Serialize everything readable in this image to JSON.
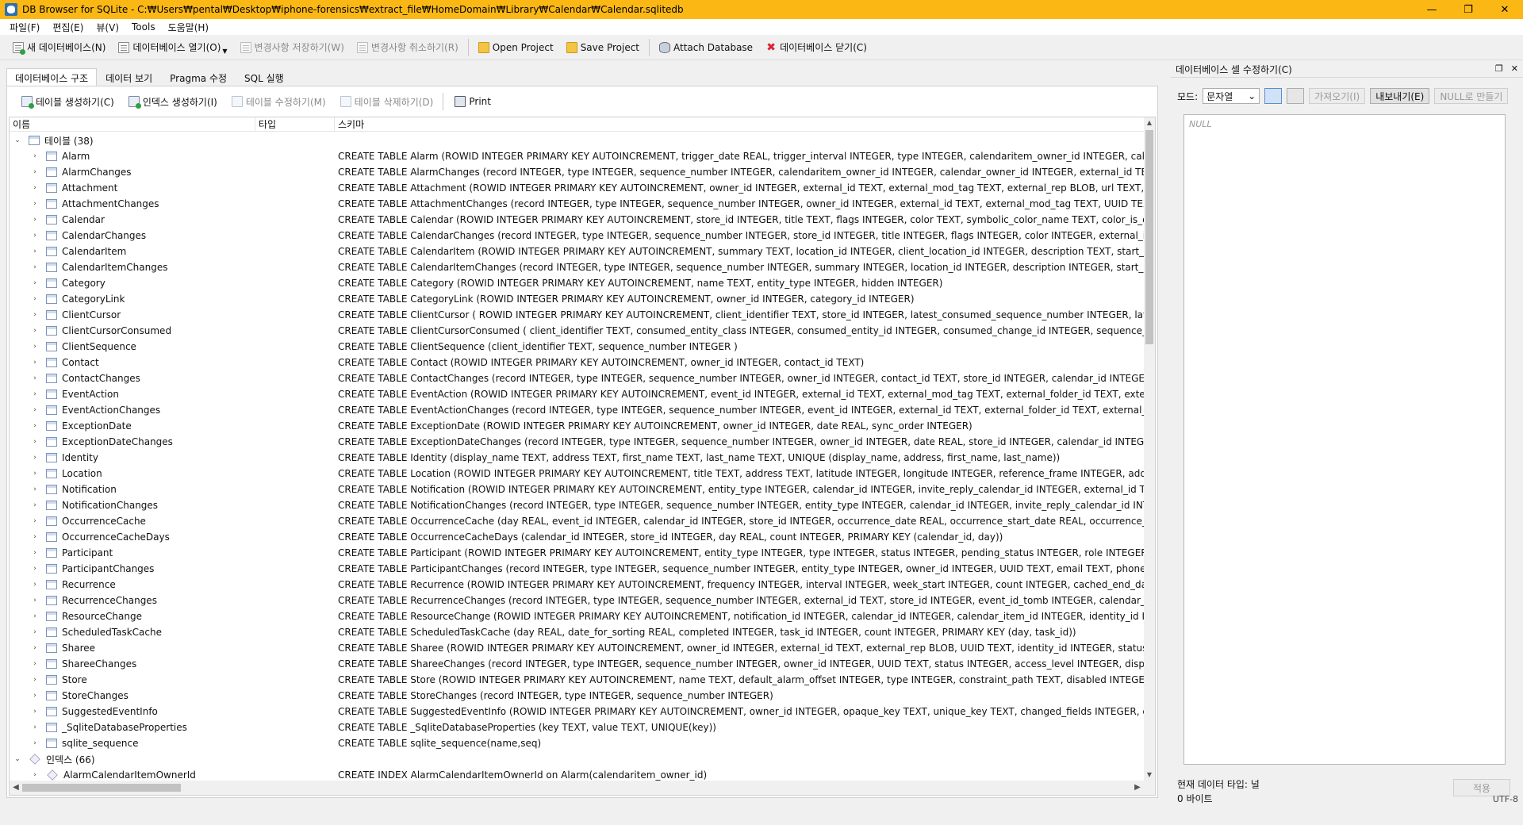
{
  "window": {
    "title": "DB Browser for SQLite - C:₩Users₩pental₩Desktop₩iphone-forensics₩extract_file₩HomeDomain₩Library₩Calendar₩Calendar.sqlitedb",
    "minimize": "—",
    "maximize": "❐",
    "close": "✕"
  },
  "menu": [
    "파일(F)",
    "편집(E)",
    "뷰(V)",
    "Tools",
    "도움말(H)"
  ],
  "toolbar": {
    "new_db": "새 데이터베이스(N)",
    "open_db": "데이터베이스 열기(O)",
    "write_changes": "변경사항 저장하기(W)",
    "revert_changes": "변경사항 취소하기(R)",
    "open_project": "Open Project",
    "save_project": "Save Project",
    "attach_db": "Attach Database",
    "close_db": "데이터베이스 닫기(C)"
  },
  "tabs": [
    "데이터베이스 구조",
    "데이터 보기",
    "Pragma 수정",
    "SQL 실행"
  ],
  "structure": {
    "actions": {
      "create_table": "테이블 생성하기(C)",
      "create_index": "인덱스 생성하기(I)",
      "modify_table": "테이블 수정하기(M)",
      "delete_table": "테이블 삭제하기(D)",
      "print": "Print"
    },
    "headers": {
      "name": "이름",
      "type": "타입",
      "schema": "스키마"
    },
    "tables_label": "테이블 (38)",
    "indexes_label": "인덱스 (66)",
    "tables": [
      {
        "name": "Alarm",
        "schema": "CREATE TABLE Alarm (ROWID INTEGER PRIMARY KEY AUTOINCREMENT, trigger_date REAL, trigger_interval INTEGER, type INTEGER, calendaritem_owner_id INTEGER, calendar_owner_id INTEGE"
      },
      {
        "name": "AlarmChanges",
        "schema": "CREATE TABLE AlarmChanges (record INTEGER, type INTEGER, sequence_number INTEGER, calendaritem_owner_id INTEGER, calendar_owner_id INTEGER, external_id TEXT, store_id INTEGER, cal"
      },
      {
        "name": "Attachment",
        "schema": "CREATE TABLE Attachment (ROWID INTEGER PRIMARY KEY AUTOINCREMENT, owner_id INTEGER, external_id TEXT, external_mod_tag TEXT, external_rep BLOB, url TEXT, UUID TEXT, data BLOB"
      },
      {
        "name": "AttachmentChanges",
        "schema": "CREATE TABLE AttachmentChanges (record INTEGER, type INTEGER, sequence_number INTEGER, owner_id INTEGER, external_id TEXT, external_mod_tag TEXT, UUID TEXT, store_id INTEGER, cale"
      },
      {
        "name": "Calendar",
        "schema": "CREATE TABLE Calendar (ROWID INTEGER PRIMARY KEY AUTOINCREMENT, store_id INTEGER, title TEXT, flags INTEGER, color TEXT, symbolic_color_name TEXT, color_is_display INTEGER, type T"
      },
      {
        "name": "CalendarChanges",
        "schema": "CREATE TABLE CalendarChanges (record INTEGER, type INTEGER, sequence_number INTEGER, store_id INTEGER, title INTEGER, flags INTEGER, color INTEGER, external_id TEXT, external_id_tag TE"
      },
      {
        "name": "CalendarItem",
        "schema": "CREATE TABLE CalendarItem (ROWID INTEGER PRIMARY KEY AUTOINCREMENT, summary TEXT, location_id INTEGER, client_location_id INTEGER, description TEXT, start_date REAL, start_tz TEX"
      },
      {
        "name": "CalendarItemChanges",
        "schema": "CREATE TABLE CalendarItemChanges (record INTEGER, type INTEGER, sequence_number INTEGER, summary INTEGER, location_id INTEGER, description INTEGER, start_date INTEGER, start_tz INT"
      },
      {
        "name": "Category",
        "schema": "CREATE TABLE Category (ROWID INTEGER PRIMARY KEY AUTOINCREMENT, name TEXT, entity_type INTEGER, hidden INTEGER)"
      },
      {
        "name": "CategoryLink",
        "schema": "CREATE TABLE CategoryLink (ROWID INTEGER PRIMARY KEY AUTOINCREMENT, owner_id INTEGER, category_id INTEGER)"
      },
      {
        "name": "ClientCursor",
        "schema": "CREATE TABLE ClientCursor ( ROWID INTEGER PRIMARY KEY AUTOINCREMENT, client_identifier TEXT, store_id INTEGER, latest_consumed_sequence_number INTEGER, latest_consumed_timesta"
      },
      {
        "name": "ClientCursorConsumed",
        "schema": "CREATE TABLE ClientCursorConsumed ( client_identifier TEXT, consumed_entity_class INTEGER, consumed_entity_id INTEGER, consumed_change_id INTEGER, sequence_number INTEGER )"
      },
      {
        "name": "ClientSequence",
        "schema": "CREATE TABLE ClientSequence (client_identifier TEXT, sequence_number INTEGER )"
      },
      {
        "name": "Contact",
        "schema": "CREATE TABLE Contact (ROWID INTEGER PRIMARY KEY AUTOINCREMENT, owner_id INTEGER, contact_id TEXT)"
      },
      {
        "name": "ContactChanges",
        "schema": "CREATE TABLE ContactChanges (record INTEGER, type INTEGER, sequence_number INTEGER, owner_id INTEGER, contact_id TEXT, store_id INTEGER, calendar_id INTEGER)"
      },
      {
        "name": "EventAction",
        "schema": "CREATE TABLE EventAction (ROWID INTEGER PRIMARY KEY AUTOINCREMENT, event_id INTEGER, external_id TEXT, external_mod_tag TEXT, external_folder_id TEXT, external_schedule_id TEXT, e"
      },
      {
        "name": "EventActionChanges",
        "schema": "CREATE TABLE EventActionChanges (record INTEGER, type INTEGER, sequence_number INTEGER, event_id INTEGER, external_id TEXT, external_folder_id TEXT, external_schedule_id TEXT, store_ic"
      },
      {
        "name": "ExceptionDate",
        "schema": "CREATE TABLE ExceptionDate (ROWID INTEGER PRIMARY KEY AUTOINCREMENT, owner_id INTEGER, date REAL, sync_order INTEGER)"
      },
      {
        "name": "ExceptionDateChanges",
        "schema": "CREATE TABLE ExceptionDateChanges (record INTEGER, type INTEGER, sequence_number INTEGER, owner_id INTEGER, date REAL, store_id INTEGER, calendar_id INTEGER)"
      },
      {
        "name": "Identity",
        "schema": "CREATE TABLE Identity (display_name TEXT, address TEXT, first_name TEXT, last_name TEXT, UNIQUE (display_name, address, first_name, last_name))"
      },
      {
        "name": "Location",
        "schema": "CREATE TABLE Location (ROWID INTEGER PRIMARY KEY AUTOINCREMENT, title TEXT, address TEXT, latitude INTEGER, longitude INTEGER, reference_frame INTEGER, address_book_id TEXT, ma"
      },
      {
        "name": "Notification",
        "schema": "CREATE TABLE Notification (ROWID INTEGER PRIMARY KEY AUTOINCREMENT, entity_type INTEGER, calendar_id INTEGER, invite_reply_calendar_id INTEGER, external_id TEXT, external_mod_tag"
      },
      {
        "name": "NotificationChanges",
        "schema": "CREATE TABLE NotificationChanges (record INTEGER, type INTEGER, sequence_number INTEGER, entity_type INTEGER, calendar_id INTEGER, invite_reply_calendar_id INTEGER, external_id TEXT,"
      },
      {
        "name": "OccurrenceCache",
        "schema": "CREATE TABLE OccurrenceCache (day REAL, event_id INTEGER, calendar_id INTEGER, store_id INTEGER, occurrence_date REAL, occurrence_start_date REAL, occurrence_end_date REAL)"
      },
      {
        "name": "OccurrenceCacheDays",
        "schema": "CREATE TABLE OccurrenceCacheDays (calendar_id INTEGER, store_id INTEGER, day REAL, count INTEGER, PRIMARY KEY (calendar_id, day))"
      },
      {
        "name": "Participant",
        "schema": "CREATE TABLE Participant (ROWID INTEGER PRIMARY KEY AUTOINCREMENT, entity_type INTEGER, type INTEGER, status INTEGER, pending_status INTEGER, role INTEGER, identity_id INTEGER, o"
      },
      {
        "name": "ParticipantChanges",
        "schema": "CREATE TABLE ParticipantChanges (record INTEGER, type INTEGER, sequence_number INTEGER, entity_type INTEGER, owner_id INTEGER, UUID TEXT, email TEXT, phone_number TEXT, commen"
      },
      {
        "name": "Recurrence",
        "schema": "CREATE TABLE Recurrence (ROWID INTEGER PRIMARY KEY AUTOINCREMENT, frequency INTEGER, interval INTEGER, week_start INTEGER, count INTEGER, cached_end_date REAL, cached_end_c"
      },
      {
        "name": "RecurrenceChanges",
        "schema": "CREATE TABLE RecurrenceChanges (record INTEGER, type INTEGER, sequence_number INTEGER, external_id TEXT, store_id INTEGER, event_id_tomb INTEGER, calendar_id INTEGER, end_date_tor"
      },
      {
        "name": "ResourceChange",
        "schema": "CREATE TABLE ResourceChange (ROWID INTEGER PRIMARY KEY AUTOINCREMENT, notification_id INTEGER, calendar_id INTEGER, calendar_item_id INTEGER, identity_id INTEGER, change_type"
      },
      {
        "name": "ScheduledTaskCache",
        "schema": "CREATE TABLE ScheduledTaskCache (day REAL, date_for_sorting REAL, completed INTEGER, task_id INTEGER, count INTEGER, PRIMARY KEY (day, task_id))"
      },
      {
        "name": "Sharee",
        "schema": "CREATE TABLE Sharee (ROWID INTEGER PRIMARY KEY AUTOINCREMENT, owner_id INTEGER, external_id TEXT, external_rep BLOB, UUID TEXT, identity_id INTEGER, status INTEGER, access_level"
      },
      {
        "name": "ShareeChanges",
        "schema": "CREATE TABLE ShareeChanges (record INTEGER, type INTEGER, sequence_number INTEGER, owner_id INTEGER, UUID TEXT, status INTEGER, access_level INTEGER, display_name TEXT, address T"
      },
      {
        "name": "Store",
        "schema": "CREATE TABLE Store (ROWID INTEGER PRIMARY KEY AUTOINCREMENT, name TEXT, default_alarm_offset INTEGER, type INTEGER, constraint_path TEXT, disabled INTEGER, external_id TEXT, per"
      },
      {
        "name": "StoreChanges",
        "schema": "CREATE TABLE StoreChanges (record INTEGER, type INTEGER, sequence_number INTEGER)"
      },
      {
        "name": "SuggestedEventInfo",
        "schema": "CREATE TABLE SuggestedEventInfo (ROWID INTEGER PRIMARY KEY AUTOINCREMENT, owner_id INTEGER, opaque_key TEXT, unique_key TEXT, changed_fields INTEGER, changes_acknowledgec"
      },
      {
        "name": "_SqliteDatabaseProperties",
        "schema": "CREATE TABLE _SqliteDatabaseProperties (key TEXT, value TEXT, UNIQUE(key))"
      },
      {
        "name": "sqlite_sequence",
        "schema": "CREATE TABLE sqlite_sequence(name,seq)"
      }
    ],
    "indexes": [
      {
        "name": "AlarmCalendarItemOwnerId",
        "schema": "CREATE INDEX AlarmCalendarItemOwnerId on Alarm(calendaritem_owner_id)"
      }
    ]
  },
  "cell_editor": {
    "title": "데이터베이스 셀 수정하기(C)",
    "mode_label": "모드:",
    "mode_value": "문자열",
    "import_label": "가져오기(I)",
    "export_label": "내보내기(E)",
    "set_null_label": "NULL로 만들기",
    "content": "NULL",
    "type_label": "현재 데이터 타입: 널",
    "size_label": "0 바이트",
    "apply_label": "적용"
  },
  "status": {
    "encoding": "UTF-8"
  }
}
